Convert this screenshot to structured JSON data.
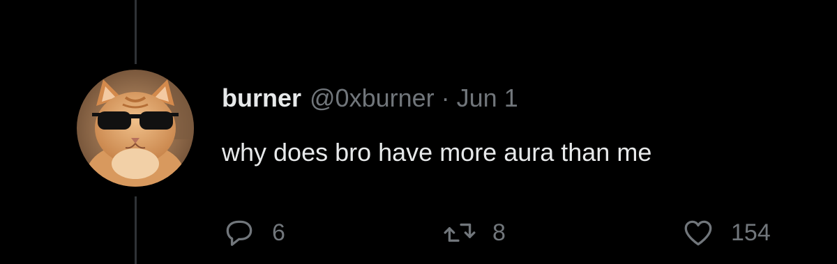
{
  "tweet": {
    "author": {
      "display_name": "burner",
      "handle": "@0xburner",
      "avatar": "cat-with-sunglasses-avatar"
    },
    "separator": "·",
    "timestamp": "Jun 1",
    "text": "why does bro have more aura than me",
    "actions": {
      "reply": {
        "icon": "reply-bubble-icon",
        "count": "6"
      },
      "retweet": {
        "icon": "retweet-icon",
        "count": "8"
      },
      "like": {
        "icon": "heart-icon",
        "count": "154"
      }
    }
  },
  "colors": {
    "background": "#000000",
    "primary_text": "#e7e9ea",
    "secondary_text": "#71767b",
    "thread_line": "#2f3336"
  }
}
